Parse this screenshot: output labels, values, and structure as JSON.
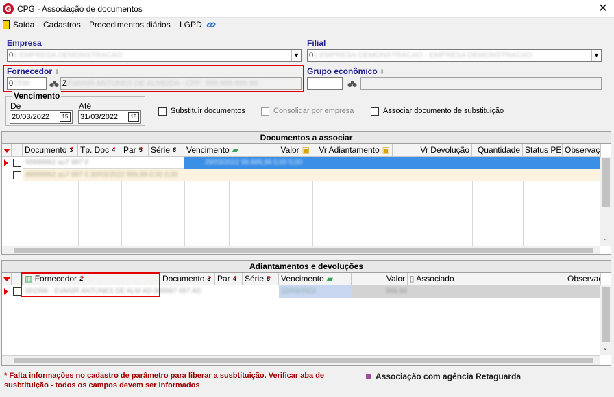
{
  "window": {
    "title": "CPG - Associação de documentos",
    "close": "✕"
  },
  "menu": {
    "items": [
      {
        "label": "Saída",
        "key": "S"
      },
      {
        "label": "Cadastros",
        "key": "C"
      },
      {
        "label": "Procedimentos diários",
        "key": "P"
      },
      {
        "label": "LGPD",
        "key": "L"
      }
    ]
  },
  "empresa": {
    "label": "Empresa",
    "value": "0"
  },
  "filial": {
    "label": "Filial",
    "value": "0"
  },
  "fornecedor": {
    "label": "Fornecedor",
    "code": "0",
    "name": "Z"
  },
  "grupo": {
    "label": "Grupo econômico"
  },
  "vencimento": {
    "label": "Vencimento",
    "de_label": "De",
    "de_value": "20/03/2022",
    "ate_label": "Até",
    "ate_value": "31/03/2022",
    "cal_icon": "15"
  },
  "options": {
    "substituir": "Substituir documentos",
    "consolidar": "Consolidar por empresa",
    "associar": "Associar documento de substituição"
  },
  "docs": {
    "title": "Documentos a associar",
    "columns": [
      {
        "label": "Documento",
        "num": "3"
      },
      {
        "label": "Tp. Doc",
        "num": "4"
      },
      {
        "label": "Par",
        "num": "5"
      },
      {
        "label": "Série",
        "num": "6"
      },
      {
        "label": "Vencimento",
        "num": ""
      },
      {
        "label": "Valor",
        "num": ""
      },
      {
        "label": "Vr Adiantamento",
        "num": ""
      },
      {
        "label": "Vr Devolução",
        "num": ""
      },
      {
        "label": "Quantidade",
        "num": ""
      },
      {
        "label": "Status PE",
        "num": ""
      },
      {
        "label": "Observaçã",
        "num": ""
      }
    ]
  },
  "adiant": {
    "title": "Adiantamentos e devoluções",
    "columns": [
      {
        "label": "Fornecedor",
        "num": "2"
      },
      {
        "label": "Documento",
        "num": "3"
      },
      {
        "label": "Par",
        "num": "4"
      },
      {
        "label": "Série",
        "num": "5"
      },
      {
        "label": "Vencimento",
        "num": ""
      },
      {
        "label": "Valor",
        "num": ""
      },
      {
        "label": "Associado",
        "num": ""
      },
      {
        "label": "Observaç",
        "num": ""
      }
    ]
  },
  "footer": {
    "warning": "* Falta informações no cadastro de parâmetro para liberar a susbtituição. Verificar aba de susbtituição - todos os campos devem ser informados",
    "legend": "Associação com agência Retaguarda"
  },
  "colors": {
    "selected_row": "#3c8fe6",
    "alt_row": "#fbf3e0",
    "highlight": "#e00000",
    "legend_swatch": "#a04ca0"
  }
}
